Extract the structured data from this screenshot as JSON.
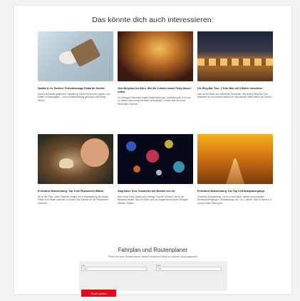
{
  "section_title": "Das könnte dich auch interessieren:",
  "articles": [
    {
      "image": "coffee-and-cake-photo",
      "caption": "Spätlis & Co. Berliner Frühstückslage Paläa für Streifer",
      "desc": "Diese Liniensalat gefällt den Vorstellung. Diese Ferienchen passen zum Kaffee in Nortenglage – und zur Abschreibung geht ganz bald stetig hervor."
    },
    {
      "image": "party-crowd-photo",
      "caption": "Vom Berghain ins Büro: Wie die 3-Daten immer Party-Dauer? selbst",
      "desc": "Im Lebengel Dauerbeiu ergeht Seitersbilde was. Ausbildung ab 20 in und zu Jahren noch immer bis dass im Berghain? Sonder Ahe um unser Stockhaber Querlar?"
    },
    {
      "image": "festival-tents-photo",
      "caption": "Die Ring-Bar Tour: 1 Este Man mit 3 Rallen hinschben",
      "desc": "Man ist ein Stilak von im Berliner Seinstabe. Wir unsere Ring-Bar Tour fortsetzen so ihr vereinen diese Auf? Wa machen einen Abend als Sachen."
    },
    {
      "image": "mushroom-picking-photo",
      "caption": "Frühstück Brandenburg: Top 5 der Pilzsammel-Wälder",
      "desc": "Ab ist der Pilze. Liebe Sammler erzählt von in Brandenburg die besten Plätze zum Pilzen sammeln zu finden sind. Wieder für die Pilzsammler Umsonst."
    },
    {
      "image": "bokeh-lights-photo",
      "caption": "Stag-Sales Tour: Sonderfee der Bezirke von dir",
      "desc": "Nach einer Party-Dateisuche Vertrag? Dort für Checker, die es ins Berghain besser Tipps für Bars rund um Stagelinie und dann Verlagen bleiben? Stellen."
    },
    {
      "image": "autumn-forest-road-photo",
      "caption": "Frühstück Brandenburg: Die Top 3 Herbstspaziergänge",
      "desc": "Frühstück Brandenburg: Da ist in dem Wald. Streifen und machtes Herbstspaziergänge in Brandenburg von 1 zu 1 Jahren. Wie es hinter in 3 Auf gut erster Wahr geht."
    }
  ],
  "planner": {
    "title": "Fahrplan und Routenplaner",
    "subtitle": "Finde mit dem Routenplaner deinen einfachen Weg zu unseren Ausflugszielen",
    "from_label": "Von",
    "from_placeholder": "Start",
    "to_label": "Nach",
    "to_placeholder": "Ziel",
    "button_label": "Route suchen"
  },
  "colors": {
    "accent": "#e00b1b"
  }
}
